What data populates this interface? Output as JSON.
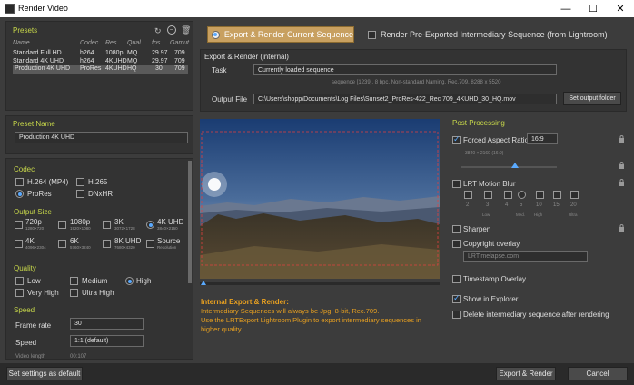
{
  "window": {
    "title": "Render Video"
  },
  "presets": {
    "heading": "Presets",
    "columns": [
      "Name",
      "Codec",
      "Res",
      "Qual",
      "fps",
      "Gamut"
    ],
    "rows": [
      [
        "Standard Full HD",
        "h264",
        "1080p",
        "MQ",
        "29.97",
        "709"
      ],
      [
        "Standard 4K UHD",
        "h264",
        "4KUHD",
        "MQ",
        "29.97",
        "709"
      ],
      [
        "Production 4K UHD",
        "ProRes",
        "4KUHD",
        "HQ",
        "30",
        "709"
      ]
    ],
    "selected_index": 2
  },
  "preset_name": {
    "heading": "Preset Name",
    "value": "Production 4K UHD"
  },
  "codec": {
    "heading": "Codec",
    "options": [
      "H.264 (MP4)",
      "H.265",
      "ProRes",
      "DNxHR"
    ],
    "selected": "ProRes"
  },
  "output_size": {
    "heading": "Output Size",
    "options": [
      {
        "label": "720p",
        "sub": "1280×720"
      },
      {
        "label": "1080p",
        "sub": "1920×1080"
      },
      {
        "label": "3K",
        "sub": "3072×1728"
      },
      {
        "label": "4K UHD",
        "sub": "3840×2160"
      },
      {
        "label": "4K",
        "sub": "4096×2304"
      },
      {
        "label": "6K",
        "sub": "5760×3240"
      },
      {
        "label": "8K UHD",
        "sub": "7680×4320"
      },
      {
        "label": "Source",
        "sub": "Resolution"
      }
    ],
    "selected": "4K UHD"
  },
  "quality": {
    "heading": "Quality",
    "options": [
      "Low",
      "Medium",
      "High",
      "Very High",
      "Ultra High"
    ],
    "selected": "High"
  },
  "speed": {
    "heading": "Speed",
    "frame_rate_label": "Frame rate",
    "frame_rate_value": "30",
    "speed_label": "Speed",
    "speed_value": "1:1 (default)",
    "video_length_label": "Video length",
    "video_length_value": "00:107"
  },
  "mode_buttons": {
    "export_render": "Export & Render Current Sequence",
    "pre_exported": "Render Pre-Exported Intermediary Sequence (from Lightroom)"
  },
  "export_render_internal": {
    "heading": "Export & Render (internal)",
    "task_label": "Task",
    "task_value": "Currently loaded sequence",
    "sequence_info": "sequence [1239], 8 bpc, Non-standard Naming, Rec.709, 8288 x 5520",
    "output_label": "Output File",
    "output_value": "C:\\Users\\shopp\\Documents\\Log Files\\Sunset2_ProRes-422_Rec 709_4KUHD_30_HQ.mov",
    "set_output_button": "Set output folder"
  },
  "info": {
    "title": "Internal Export & Render:",
    "line1": "Intermediary Sequences will always be Jpg, 8-bit, Rec.709.",
    "line2": "Use the LRTExport Lightroom Plugin to export intermediary sequences in higher quality."
  },
  "post_processing": {
    "heading": "Post Processing",
    "forced_aspect_label": "Forced Aspect Ratio",
    "forced_aspect_value": "16:9",
    "aspect_info": "3840 × 2160 (16:9)",
    "aspect_slider_fraction": 0.4,
    "motion_blur_label": "LRT Motion Blur",
    "motion_blur_values": [
      "2",
      "3",
      "4",
      "5",
      "10",
      "15",
      "20"
    ],
    "motion_blur_captions": [
      "Low",
      "Med.",
      "High",
      "Ultra"
    ],
    "sharpen_label": "Sharpen",
    "copyright_label": "Copyright overlay",
    "copyright_placeholder": "LRTimelapse.com",
    "timestamp_label": "Timestamp Overlay",
    "show_explorer_label": "Show in Explorer",
    "delete_label": "Delete intermediary sequence after rendering",
    "forced_aspect_checked": true,
    "show_explorer_checked": true
  },
  "footer": {
    "set_default": "Set settings as default",
    "export_render": "Export & Render",
    "cancel": "Cancel"
  },
  "colors": {
    "accent_heading": "#c8d84a",
    "accent_blue": "#5aaaff",
    "info_orange": "#e8a020",
    "mode_button": "#c8a060"
  }
}
